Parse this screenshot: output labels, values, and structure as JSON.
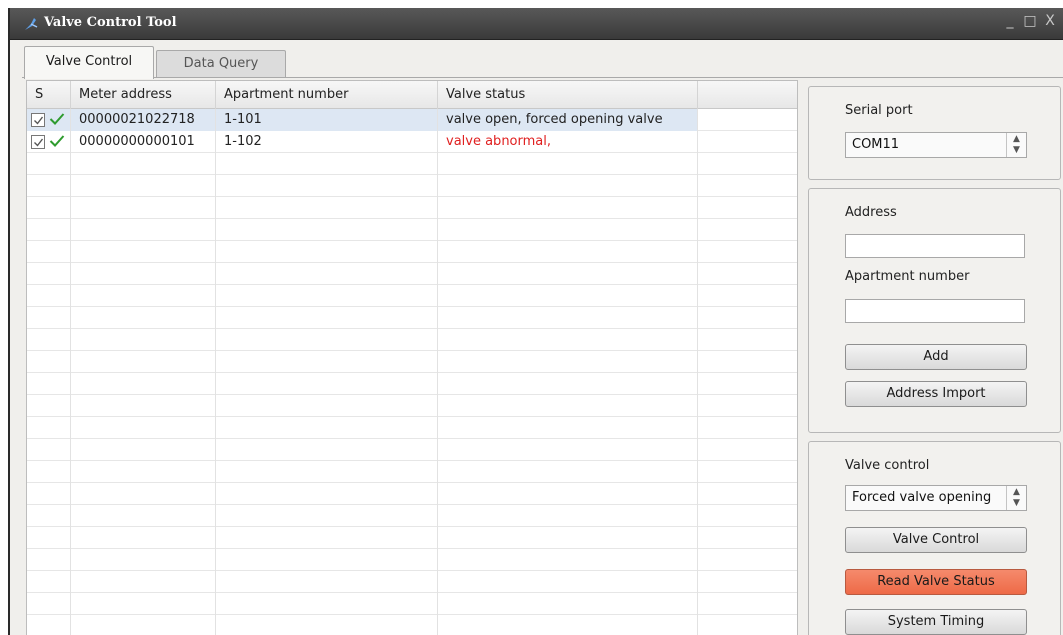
{
  "window": {
    "title": "Valve Control Tool",
    "controls": [
      "_",
      "□",
      "X"
    ]
  },
  "tabs": [
    {
      "label": "Valve Control",
      "active": true
    },
    {
      "label": "Data Query",
      "active": false
    }
  ],
  "table": {
    "columns": [
      "S",
      "Meter address",
      "Apartment number",
      "Valve status",
      ""
    ],
    "rows": [
      {
        "checked": true,
        "meter_address": "00000021022718",
        "apartment": "1-101",
        "status": "valve open, forced opening valve",
        "status_color": "#222222",
        "selected": true
      },
      {
        "checked": true,
        "meter_address": "00000000000101",
        "apartment": "1-102",
        "status": "valve abnormal,",
        "status_color": "#e02020",
        "selected": false
      }
    ]
  },
  "serial": {
    "label": "Serial port",
    "value": "COM11"
  },
  "address_panel": {
    "address_label": "Address",
    "address_value": "",
    "apartment_label": "Apartment number",
    "apartment_value": "",
    "add_label": "Add",
    "import_label": "Address Import"
  },
  "valve_panel": {
    "label": "Valve control",
    "mode_value": "Forced valve opening",
    "control_label": "Valve Control",
    "read_label": "Read Valve Status",
    "timing_label": "System Timing"
  },
  "colors": {
    "accent": "#ee6a47",
    "check_green": "#2e9b2e",
    "error_red": "#e02020",
    "title_bar": "#3a3a3a"
  },
  "icons": {
    "title": "valve-tool-icon",
    "check": "checkbox-icon",
    "ok": "green-check-icon",
    "spin": "spin-arrows-icon"
  }
}
